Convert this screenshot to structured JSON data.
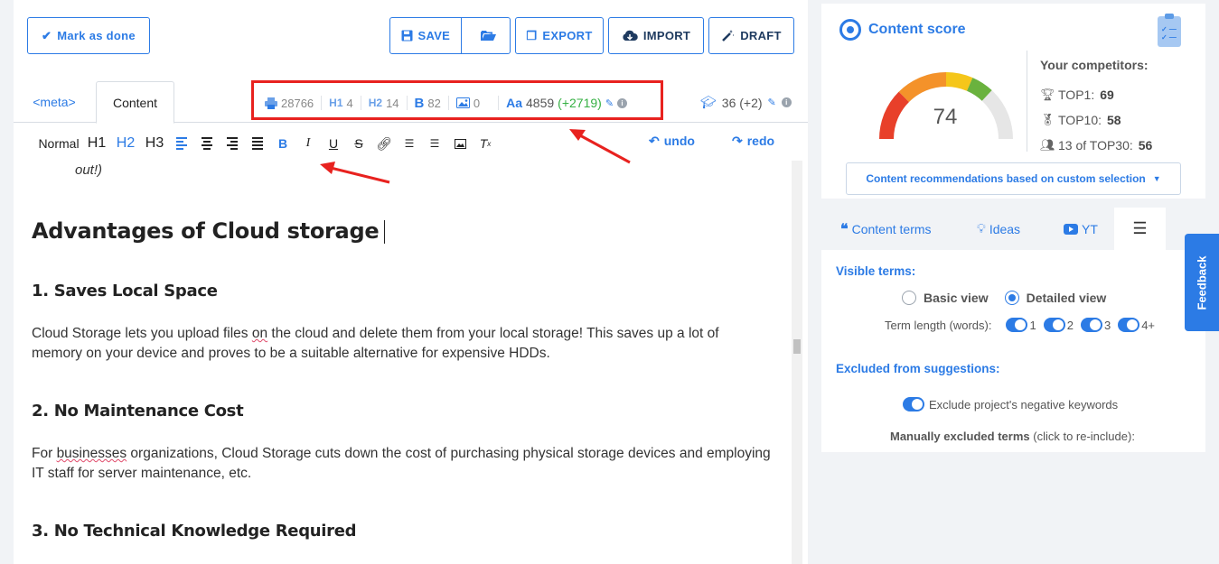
{
  "toolbar_top": {
    "mark_done": "Mark as done",
    "save": "SAVE",
    "export": "EXPORT",
    "import": "IMPORT",
    "draft": "DRAFT"
  },
  "tabs": {
    "meta": "<meta>",
    "content": "Content"
  },
  "stats": {
    "chars": "28766",
    "h1_label": "H1",
    "h1": "4",
    "h2_label": "H2",
    "h2": "14",
    "bold_label": "B",
    "bold": "82",
    "images": "0",
    "words_label": "Aa",
    "words": "4859",
    "words_delta": "(+2719)",
    "readability": "36 (+2)"
  },
  "format_toolbar": {
    "normal": "Normal",
    "h1": "H1",
    "h2": "H2",
    "h3": "H3",
    "bold": "B",
    "italic": "I",
    "underline": "U",
    "strike": "S",
    "undo": "undo",
    "redo": "redo"
  },
  "document": {
    "fragment": "out!)",
    "heading": "Advantages of Cloud storage",
    "s1_title": "1. Saves Local Space",
    "s1_a": "Cloud Storage lets you upload files ",
    "s1_err": "on",
    "s1_b": " the cloud and delete them from your local storage! This saves up a lot of memory on your device and proves to be a suitable alternative for expensive HDDs.",
    "s2_title": "2. No Maintenance Cost",
    "s2_a": "For ",
    "s2_err": "businesses",
    "s2_b": " organizations, Cloud Storage cuts down the cost of purchasing physical storage devices and employing IT staff for server maintenance, etc.",
    "s3_title": "3. No Technical Knowledge Required"
  },
  "score": {
    "title": "Content score",
    "value": "74",
    "gauge_fraction": 0.74,
    "competitors_head": "Your competitors:",
    "top1_label": "TOP1:",
    "top1": "69",
    "top10_label": "TOP10:",
    "top10": "58",
    "top30_label": "13 of TOP30:",
    "top30": "56",
    "recommendations": "Content recommendations based on custom selection"
  },
  "side_tabs": {
    "terms": "Content terms",
    "ideas": "Ideas",
    "yt": "YT"
  },
  "settings": {
    "visible_terms": "Visible terms:",
    "basic_view": "Basic view",
    "detailed_view": "Detailed view",
    "term_length": "Term length (words):",
    "len1": "1",
    "len2": "2",
    "len3": "3",
    "len4": "4+",
    "excluded": "Excluded from suggestions:",
    "exclude_negative": "Exclude project's negative keywords",
    "manual_bold": "Manually excluded terms",
    "manual_rest": " (click to re-include):"
  },
  "feedback": "Feedback",
  "colors": {
    "accent": "#2c7be5",
    "highlight": "#e8221f",
    "positive": "#35b043"
  }
}
